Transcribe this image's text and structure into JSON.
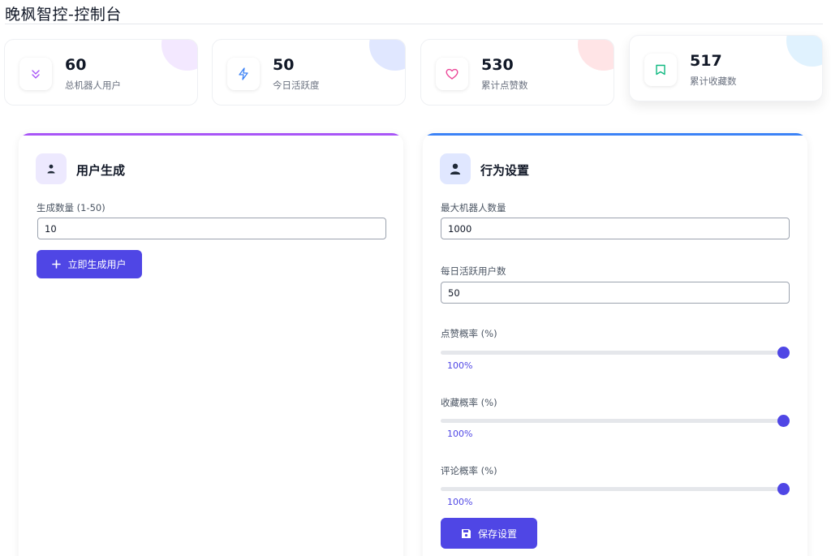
{
  "header": {
    "title": "晚枫智控-控制台"
  },
  "stats": [
    {
      "value": "60",
      "label": "总机器人用户",
      "icon": "chevrons-down-icon",
      "accent": "#a855f7",
      "blob": "#f3e8ff"
    },
    {
      "value": "50",
      "label": "今日活跃度",
      "icon": "lightning-icon",
      "accent": "#3b82f6",
      "blob": "#e0e7ff"
    },
    {
      "value": "530",
      "label": "累计点赞数",
      "icon": "heart-icon",
      "accent": "#ec4899",
      "blob": "#ffe4e6"
    },
    {
      "value": "517",
      "label": "累计收藏数",
      "icon": "bookmark-icon",
      "accent": "#10b981",
      "blob": "#e0f2fe"
    }
  ],
  "user_gen": {
    "title": "用户生成",
    "count_label": "生成数量 (1-50)",
    "count_value": "10",
    "button_label": "立即生成用户",
    "accent": "#a855f7"
  },
  "behavior": {
    "title": "行为设置",
    "max_bots_label": "最大机器人数量",
    "max_bots_value": "1000",
    "daily_active_label": "每日活跃用户数",
    "daily_active_value": "50",
    "like_rate_label": "点赞概率 (%)",
    "like_rate_value": "100%",
    "like_rate_level": 100,
    "fav_rate_label": "收藏概率 (%)",
    "fav_rate_value": "100%",
    "fav_rate_level": 100,
    "comment_rate_label": "评论概率 (%)",
    "comment_rate_value": "100%",
    "comment_rate_level": 100,
    "save_label": "保存设置",
    "accent": "#3b82f6"
  }
}
